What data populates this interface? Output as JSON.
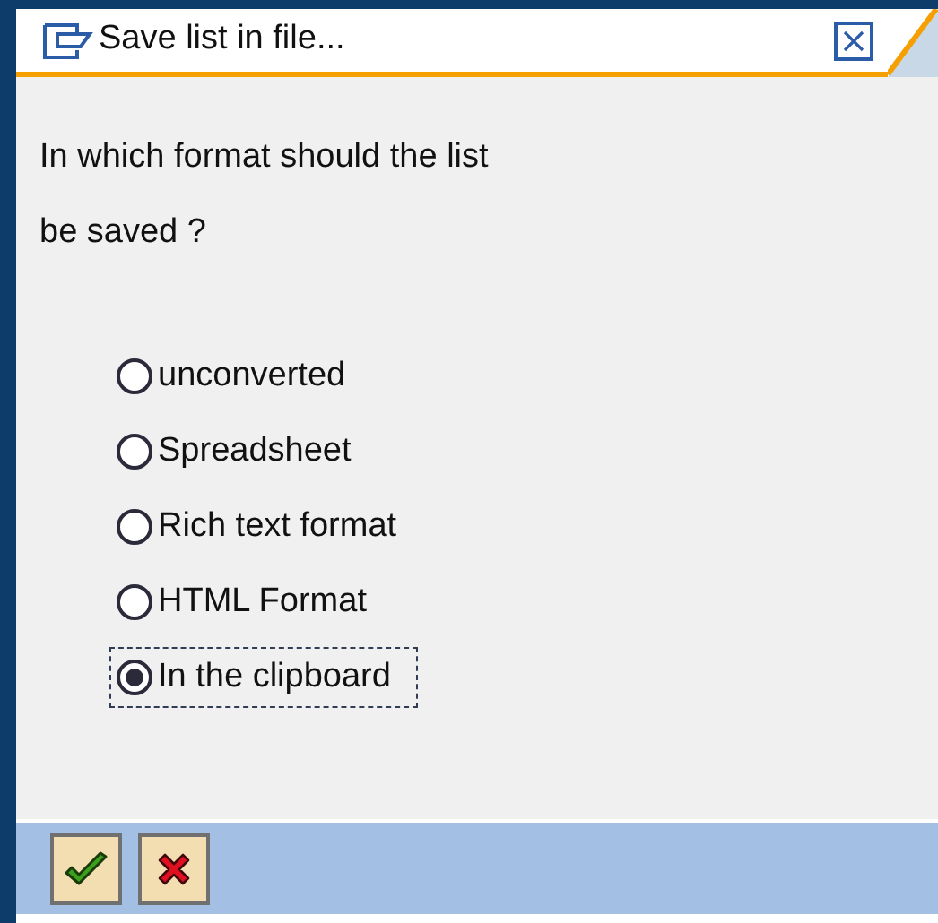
{
  "window": {
    "title": "Save list in file..."
  },
  "question": {
    "lines": [
      "In which format should the list",
      "be saved ?"
    ]
  },
  "options": [
    {
      "label": "unconverted",
      "selected": false,
      "focused": false
    },
    {
      "label": "Spreadsheet",
      "selected": false,
      "focused": false
    },
    {
      "label": "Rich text format",
      "selected": false,
      "focused": false
    },
    {
      "label": "HTML Format",
      "selected": false,
      "focused": false
    },
    {
      "label": "In the clipboard",
      "selected": true,
      "focused": true
    }
  ],
  "buttons": [
    {
      "kind": "confirm"
    },
    {
      "kind": "cancel"
    }
  ]
}
